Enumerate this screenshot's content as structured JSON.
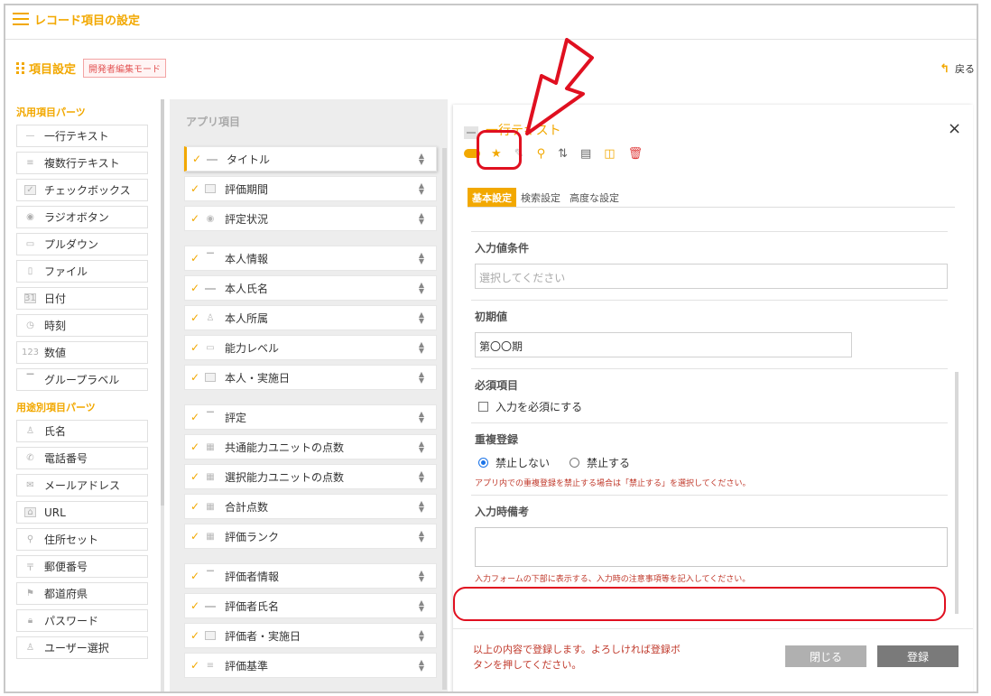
{
  "window": {
    "title": "レコード項目の設定"
  },
  "section": {
    "title": "項目設定",
    "mode_badge": "開発者編集モード",
    "back_label": "戻る"
  },
  "left": {
    "general_title": "汎用項目パーツ",
    "general": [
      "一行テキスト",
      "複数行テキスト",
      "チェックボックス",
      "ラジオボタン",
      "プルダウン",
      "ファイル",
      "日付",
      "時刻",
      "数値",
      "グループラベル"
    ],
    "special_title": "用途別項目パーツ",
    "special": [
      "氏名",
      "電話番号",
      "メールアドレス",
      "URL",
      "住所セット",
      "郵便番号",
      "都道府県",
      "パスワード",
      "ユーザー選択"
    ],
    "icons": {
      "number": "123",
      "date": "31"
    }
  },
  "mid": {
    "title": "アプリ項目",
    "items": [
      "タイトル",
      "評価期間",
      "評定状況",
      "本人情報",
      "本人氏名",
      "本人所属",
      "能力レベル",
      "本人・実施日",
      "評定",
      "共通能力ユニットの点数",
      "選択能力ユニットの点数",
      "合計点数",
      "評価ランク",
      "評価者情報",
      "評価者氏名",
      "評価者・実施日",
      "評価基準"
    ]
  },
  "panel": {
    "title": "一行テキスト",
    "close": "×",
    "tabs": [
      "基本設定",
      "検索設定",
      "高度な設定"
    ],
    "input_condition_label": "入力値条件",
    "input_condition_placeholder": "選択してください",
    "initial_label": "初期値",
    "initial_value": "第〇〇期",
    "required_label": "必須項目",
    "required_check": "入力を必須にする",
    "duplicate_label": "重複登録",
    "dup_no": "禁止しない",
    "dup_yes": "禁止する",
    "dup_note": "アプリ内での重複登録を禁止する場合は「禁止する」を選択してください。",
    "memo_label": "入力時備考",
    "memo_note": "入力フォームの下部に表示する、入力時の注意事項等を記入してください。",
    "footer_msg": "以上の内容で登録します。よろしければ登録ボタンを押してください。",
    "btn_close": "閉じる",
    "btn_submit": "登録"
  },
  "colors": {
    "accent": "#f2a800",
    "highlight": "#e01020",
    "danger": "#e04040"
  }
}
